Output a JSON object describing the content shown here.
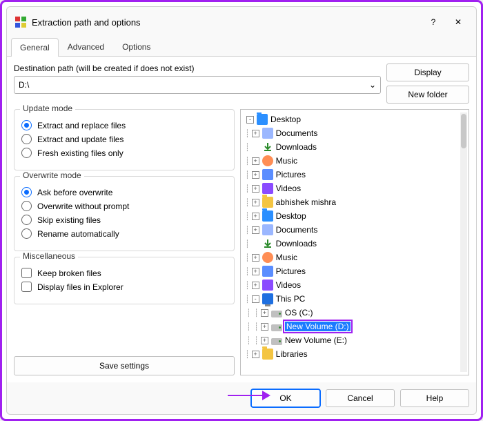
{
  "title": "Extraction path and options",
  "tabs": [
    "General",
    "Advanced",
    "Options"
  ],
  "active_tab": 0,
  "dest_label": "Destination path (will be created if does not exist)",
  "dest_value": "D:\\",
  "btn_display": "Display",
  "btn_newfolder": "New folder",
  "update_mode": {
    "legend": "Update mode",
    "options": [
      "Extract and replace files",
      "Extract and update files",
      "Fresh existing files only"
    ],
    "selected": 0
  },
  "overwrite_mode": {
    "legend": "Overwrite mode",
    "options": [
      "Ask before overwrite",
      "Overwrite without prompt",
      "Skip existing files",
      "Rename automatically"
    ],
    "selected": 0
  },
  "misc": {
    "legend": "Miscellaneous",
    "options": [
      "Keep broken files",
      "Display files in Explorer"
    ]
  },
  "btn_save": "Save settings",
  "tree": [
    {
      "depth": 0,
      "exp": "-",
      "icon": "folder blue",
      "label": "Desktop"
    },
    {
      "depth": 1,
      "exp": "+",
      "icon": "doc",
      "label": "Documents"
    },
    {
      "depth": 1,
      "exp": "",
      "icon": "dl",
      "label": "Downloads"
    },
    {
      "depth": 1,
      "exp": "+",
      "icon": "music",
      "label": "Music"
    },
    {
      "depth": 1,
      "exp": "+",
      "icon": "pic",
      "label": "Pictures"
    },
    {
      "depth": 1,
      "exp": "+",
      "icon": "vid",
      "label": "Videos"
    },
    {
      "depth": 1,
      "exp": "+",
      "icon": "folder",
      "label": "abhishek mishra"
    },
    {
      "depth": 1,
      "exp": "+",
      "icon": "folder blue",
      "label": "Desktop"
    },
    {
      "depth": 1,
      "exp": "+",
      "icon": "doc",
      "label": "Documents"
    },
    {
      "depth": 1,
      "exp": "",
      "icon": "dl",
      "label": "Downloads"
    },
    {
      "depth": 1,
      "exp": "+",
      "icon": "music",
      "label": "Music"
    },
    {
      "depth": 1,
      "exp": "+",
      "icon": "pic",
      "label": "Pictures"
    },
    {
      "depth": 1,
      "exp": "+",
      "icon": "vid",
      "label": "Videos"
    },
    {
      "depth": 1,
      "exp": "-",
      "icon": "monitor",
      "label": "This PC"
    },
    {
      "depth": 2,
      "exp": "+",
      "icon": "drive",
      "label": "OS (C:)"
    },
    {
      "depth": 2,
      "exp": "+",
      "icon": "drive",
      "label": "New Volume (D:)",
      "selected": true
    },
    {
      "depth": 2,
      "exp": "+",
      "icon": "drive",
      "label": "New Volume (E:)"
    },
    {
      "depth": 1,
      "exp": "+",
      "icon": "folder",
      "label": "Libraries"
    }
  ],
  "footer": {
    "ok": "OK",
    "cancel": "Cancel",
    "help": "Help"
  }
}
